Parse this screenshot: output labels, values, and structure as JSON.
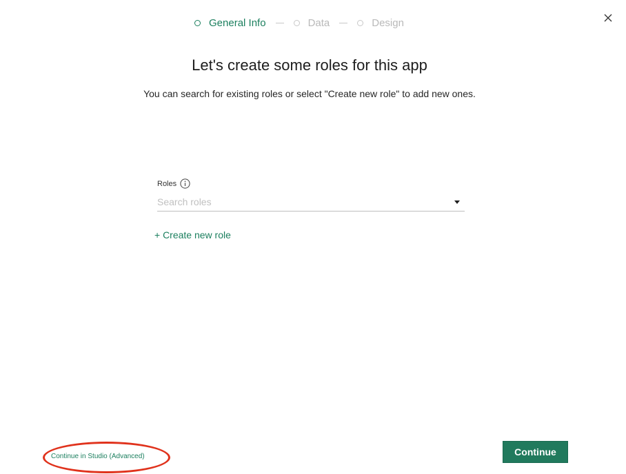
{
  "stepper": {
    "steps": [
      {
        "label": "General Info",
        "active": true
      },
      {
        "label": "Data",
        "active": false
      },
      {
        "label": "Design",
        "active": false
      }
    ]
  },
  "header": {
    "close_icon": "close-icon"
  },
  "main": {
    "title": "Let's create some roles for this app",
    "subtitle": "You can search for existing roles or select \"Create new role\" to add new ones."
  },
  "roles_field": {
    "label": "Roles",
    "info_icon": "info-icon",
    "placeholder": "Search roles",
    "value": "",
    "dropdown_icon": "caret-down-icon"
  },
  "actions": {
    "create_role_label": "+ Create new role",
    "advanced_link_label": "Continue in Studio (Advanced)",
    "continue_label": "Continue"
  },
  "colors": {
    "accent": "#1b7f5e",
    "button_bg": "#217a5d",
    "highlight": "#e0321c"
  }
}
